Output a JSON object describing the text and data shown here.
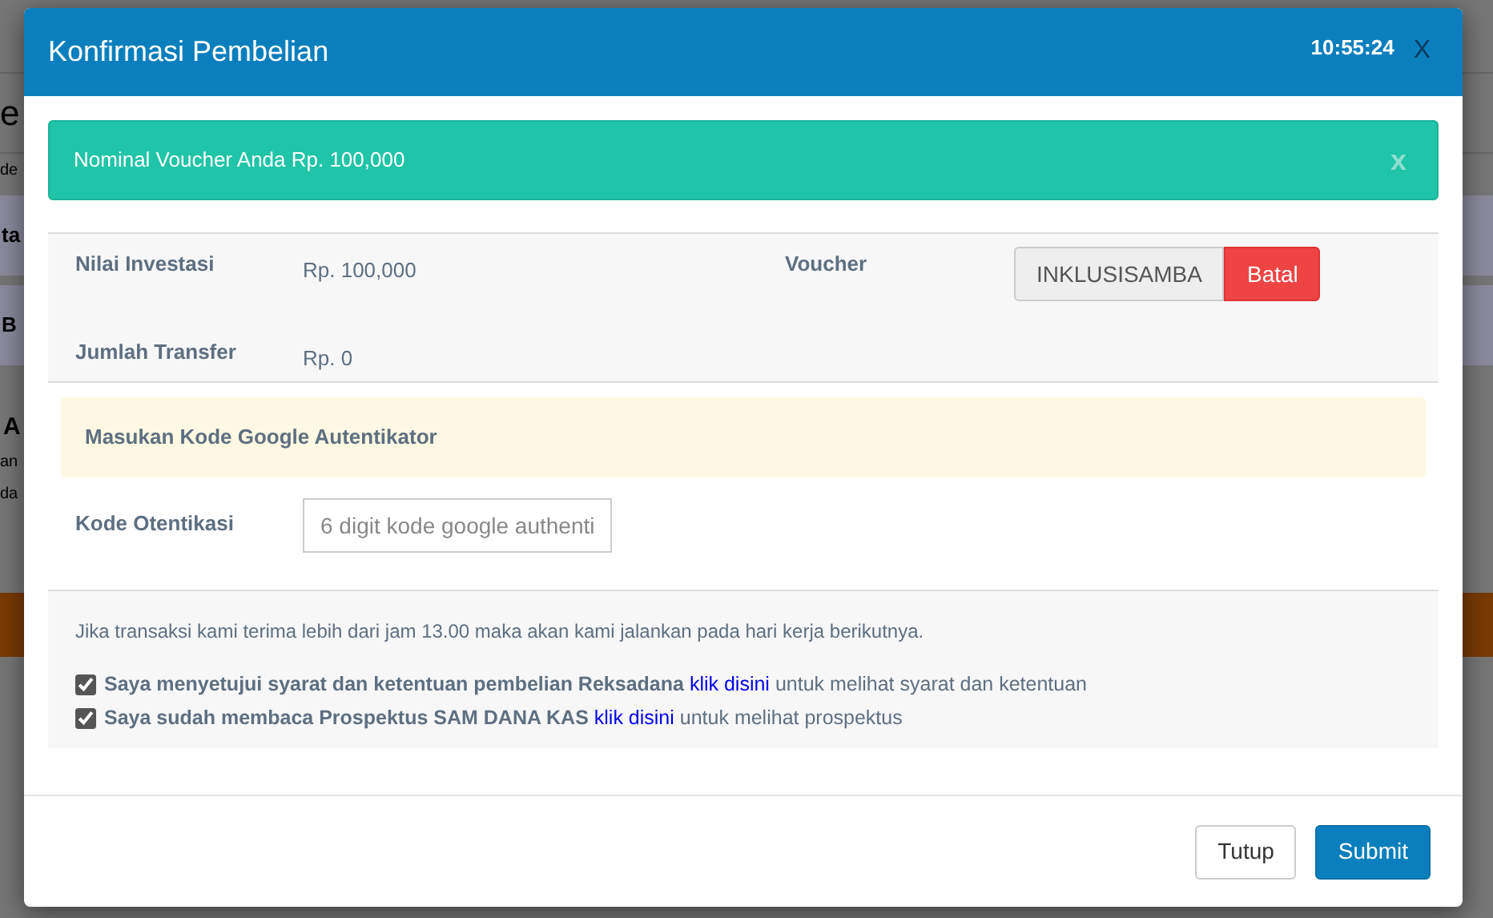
{
  "background": {
    "fragments": [
      {
        "kind": "title",
        "text": "e"
      },
      {
        "kind": "small",
        "text": "de"
      },
      {
        "kind": "band",
        "text": "ta"
      },
      {
        "kind": "band",
        "text": "B"
      },
      {
        "kind": "heading",
        "text": "A"
      },
      {
        "kind": "small",
        "text": "an"
      },
      {
        "kind": "small",
        "text": "da"
      },
      {
        "kind": "orange"
      }
    ]
  },
  "modal": {
    "title": "Konfirmasi Pembelian",
    "time": "10:55:24",
    "close": "X",
    "alert": {
      "text": "Nominal Voucher Anda Rp. 100,000",
      "close": "x"
    },
    "summary": [
      {
        "label": "Nilai Investasi",
        "value": "Rp. 100,000"
      },
      {
        "label": "Jumlah Transfer",
        "value": "Rp. 0"
      }
    ],
    "voucher": {
      "label": "Voucher",
      "code": "INKLUSISAMBA",
      "cancel": "Batal"
    },
    "auth_notice": "Masukan Kode Google Autentikator",
    "auth_field": {
      "label": "Kode Otentikasi",
      "placeholder": "6 digit kode google authenti"
    },
    "note": "Jika transaksi kami terima lebih dari jam 13.00 maka akan kami jalankan pada hari kerja berikutnya.",
    "agreements": [
      {
        "checked": true,
        "text": "Saya menyetujui syarat dan ketentuan pembelian Reksadana",
        "link": "klik disini",
        "after": "untuk melihat syarat dan ketentuan"
      },
      {
        "checked": true,
        "text": "Saya sudah membaca Prospektus SAM DANA KAS",
        "link": "klik disini",
        "after": "untuk melihat prospektus"
      }
    ],
    "buttons": [
      {
        "kind": "default",
        "label": "Tutup"
      },
      {
        "kind": "primary",
        "label": "Submit"
      }
    ]
  }
}
